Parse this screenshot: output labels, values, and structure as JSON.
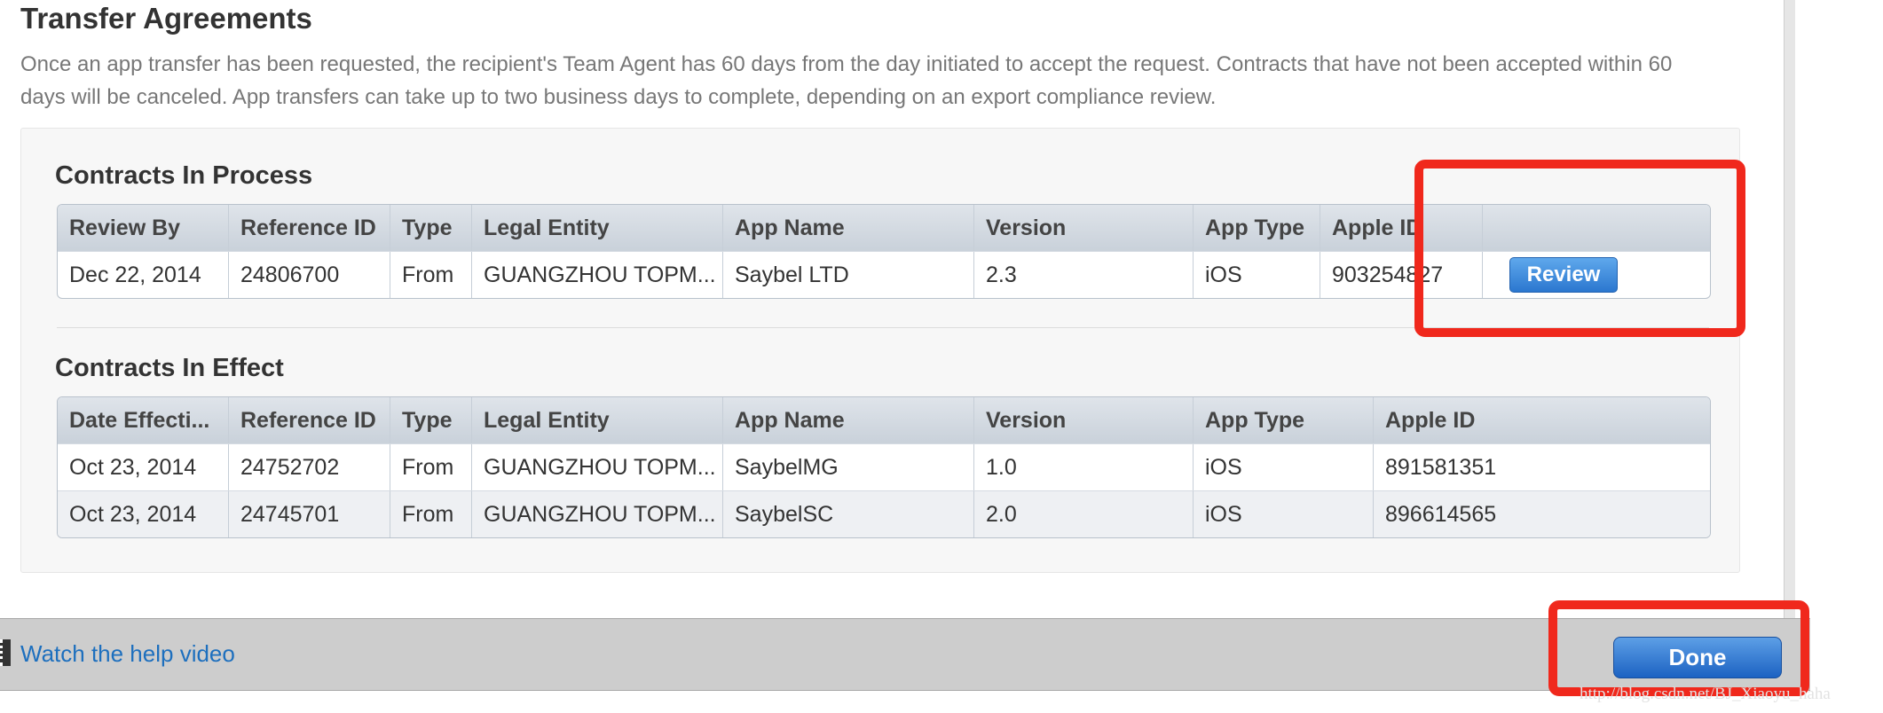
{
  "page": {
    "title": "Transfer Agreements",
    "description": "Once an app transfer has been requested, the recipient's Team Agent has 60 days from the day initiated to accept the request. Contracts that have not been accepted within 60 days will be canceled. App transfers can take up to two business days to complete, depending on an export compliance review."
  },
  "in_process": {
    "title": "Contracts In Process",
    "headers": [
      "Review By",
      "Reference ID",
      "Type",
      "Legal Entity",
      "App Name",
      "Version",
      "App Type",
      "Apple ID",
      ""
    ],
    "rows": [
      [
        "Dec 22, 2014",
        "24806700",
        "From",
        "GUANGZHOU TOPM...",
        "Saybel LTD",
        "2.3",
        "iOS",
        "903254827"
      ]
    ],
    "review_label": "Review"
  },
  "in_effect": {
    "title": "Contracts In Effect",
    "headers": [
      "Date Effecti...",
      "Reference ID",
      "Type",
      "Legal Entity",
      "App Name",
      "Version",
      "App Type",
      "Apple ID"
    ],
    "rows": [
      [
        "Oct 23, 2014",
        "24752702",
        "From",
        "GUANGZHOU TOPM...",
        "SaybelMG",
        "1.0",
        "iOS",
        "891581351"
      ],
      [
        "Oct 23, 2014",
        "24745701",
        "From",
        "GUANGZHOU TOPM...",
        "SaybelSC",
        "2.0",
        "iOS",
        "896614565"
      ]
    ]
  },
  "footer": {
    "help_link": "Watch the help video",
    "done_label": "Done",
    "watermark": "http://blog.csdn.net/BJ_Xiaoyu_haha"
  },
  "colors": {
    "highlight": "#f0281c",
    "link": "#1d6fbe",
    "button": "#2b77cf"
  }
}
